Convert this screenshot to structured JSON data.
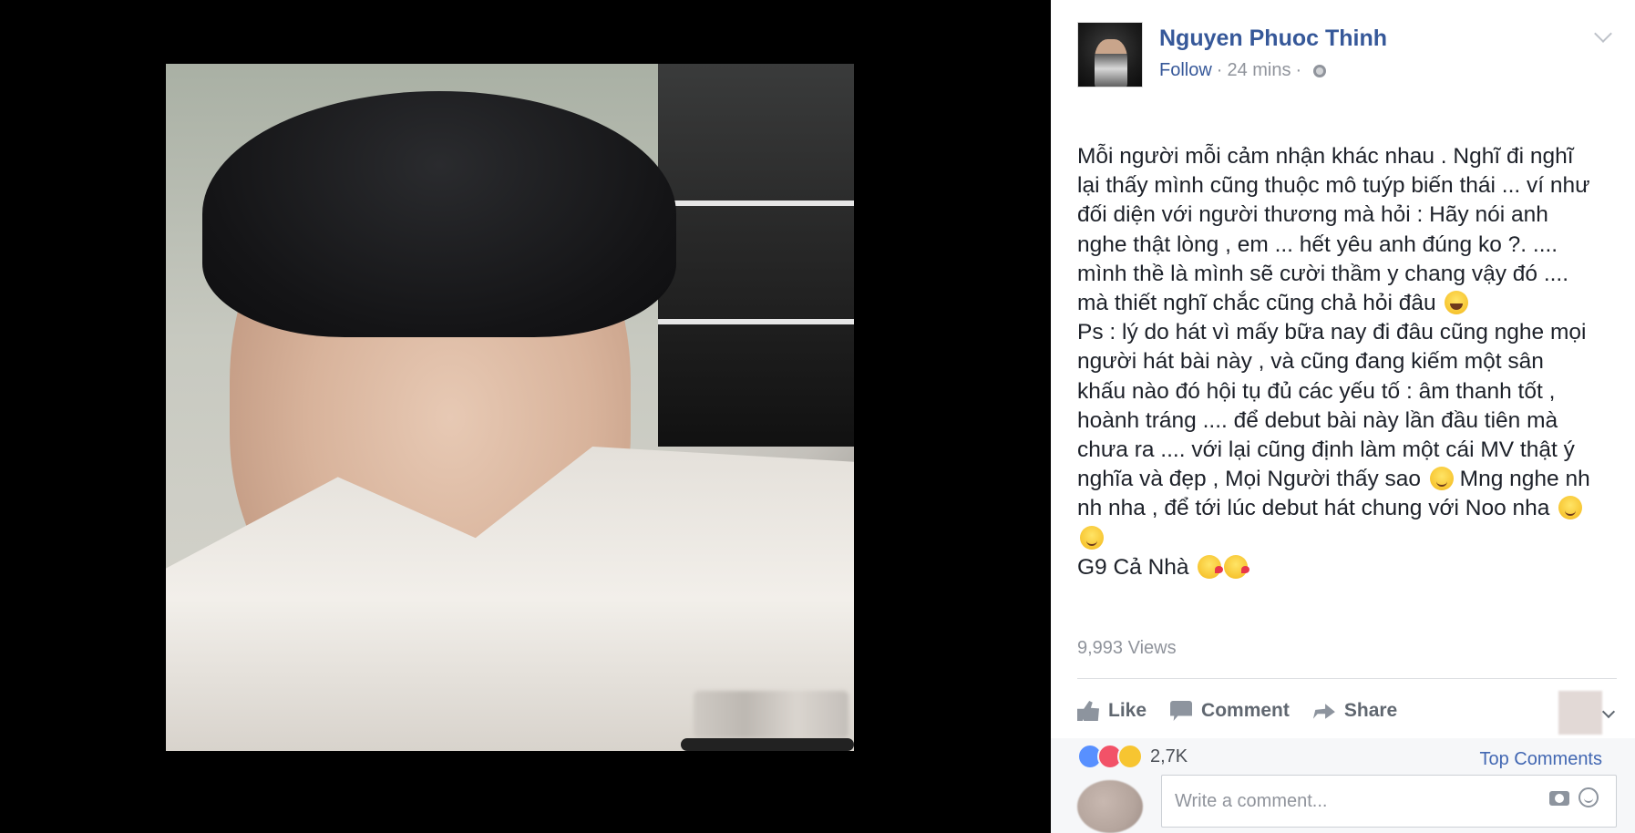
{
  "post": {
    "author_name": "Nguyen Phuoc Thinh",
    "follow_label": "Follow",
    "meta_separator": "·",
    "timestamp": "24 mins",
    "privacy_icon": "globe-icon",
    "text_lines": [
      "Mỗi người mỗi cảm nhận khác nhau . Nghĩ đi nghĩ",
      "lại thấy mình cũng thuộc mô tuýp biến thái ... ví như",
      "đối diện với người thương mà hỏi : Hãy nói anh",
      "nghe thật lòng , em ... hết yêu anh đúng ko ?. ....",
      "mình thề là mình sẽ cười thầm y chang vậy đó ....",
      "mà thiết nghĩ chắc cũng chả hỏi đâu",
      "Ps : lý do hát vì mấy bữa nay đi đâu cũng nghe mọi",
      "người hát bài này , và cũng đang kiếm một sân",
      "khấu nào đó hội tụ đủ các yếu tố : âm thanh tốt ,",
      "hoành tráng .... để debut bài này lần đầu tiên mà",
      "chưa ra .... với lại cũng định làm một cái MV thật ý",
      "nghĩa và đẹp , Mọi Người thấy sao",
      "Mng nghe nh",
      "nh nha , để tới lúc debut hát chung với Noo nha",
      "",
      "G9 Cả Nhà"
    ],
    "views": "9,993 Views"
  },
  "actions": {
    "like_label": "Like",
    "comment_label": "Comment",
    "share_label": "Share"
  },
  "reactions": {
    "count": "2,7K",
    "top_comments_label": "Top Comments"
  },
  "comment_box": {
    "placeholder": "Write a comment..."
  },
  "colors": {
    "link_blue": "#365899",
    "meta_gray": "#90949c",
    "text_dark": "#1d2129"
  }
}
